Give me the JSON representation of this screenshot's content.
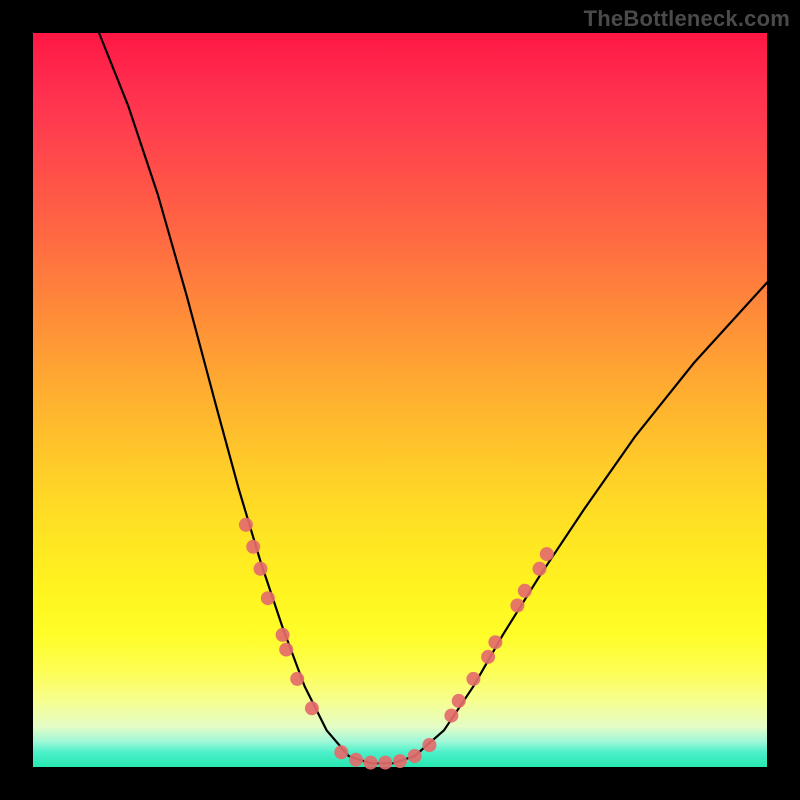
{
  "watermark": "TheBottleneck.com",
  "chart_data": {
    "type": "line",
    "title": "",
    "xlabel": "",
    "ylabel": "",
    "xlim": [
      0,
      100
    ],
    "ylim": [
      0,
      100
    ],
    "note": "Axes are unlabeled; values are estimated positions in percent of plot area (0,0 = bottom-left).",
    "curve": {
      "name": "bottleneck-curve",
      "points": [
        {
          "x": 9,
          "y": 100
        },
        {
          "x": 13,
          "y": 90
        },
        {
          "x": 17,
          "y": 78
        },
        {
          "x": 21,
          "y": 64
        },
        {
          "x": 25,
          "y": 49
        },
        {
          "x": 28,
          "y": 38
        },
        {
          "x": 31,
          "y": 28
        },
        {
          "x": 34,
          "y": 19
        },
        {
          "x": 37,
          "y": 11
        },
        {
          "x": 40,
          "y": 5
        },
        {
          "x": 43,
          "y": 1.5
        },
        {
          "x": 46,
          "y": 0.5
        },
        {
          "x": 49,
          "y": 0.5
        },
        {
          "x": 52,
          "y": 1.5
        },
        {
          "x": 56,
          "y": 5
        },
        {
          "x": 60,
          "y": 11
        },
        {
          "x": 64,
          "y": 18
        },
        {
          "x": 69,
          "y": 26
        },
        {
          "x": 75,
          "y": 35
        },
        {
          "x": 82,
          "y": 45
        },
        {
          "x": 90,
          "y": 55
        },
        {
          "x": 100,
          "y": 66
        }
      ]
    },
    "markers": {
      "name": "highlighted-points",
      "color": "#e46b6b",
      "radius_px": 7,
      "points": [
        {
          "x": 29,
          "y": 33
        },
        {
          "x": 30,
          "y": 30
        },
        {
          "x": 31,
          "y": 27
        },
        {
          "x": 32,
          "y": 23
        },
        {
          "x": 34,
          "y": 18
        },
        {
          "x": 34.5,
          "y": 16
        },
        {
          "x": 36,
          "y": 12
        },
        {
          "x": 38,
          "y": 8
        },
        {
          "x": 42,
          "y": 2
        },
        {
          "x": 44,
          "y": 1
        },
        {
          "x": 46,
          "y": 0.6
        },
        {
          "x": 48,
          "y": 0.6
        },
        {
          "x": 50,
          "y": 0.8
        },
        {
          "x": 52,
          "y": 1.5
        },
        {
          "x": 54,
          "y": 3
        },
        {
          "x": 57,
          "y": 7
        },
        {
          "x": 58,
          "y": 9
        },
        {
          "x": 60,
          "y": 12
        },
        {
          "x": 62,
          "y": 15
        },
        {
          "x": 63,
          "y": 17
        },
        {
          "x": 66,
          "y": 22
        },
        {
          "x": 67,
          "y": 24
        },
        {
          "x": 69,
          "y": 27
        },
        {
          "x": 70,
          "y": 29
        }
      ]
    }
  }
}
